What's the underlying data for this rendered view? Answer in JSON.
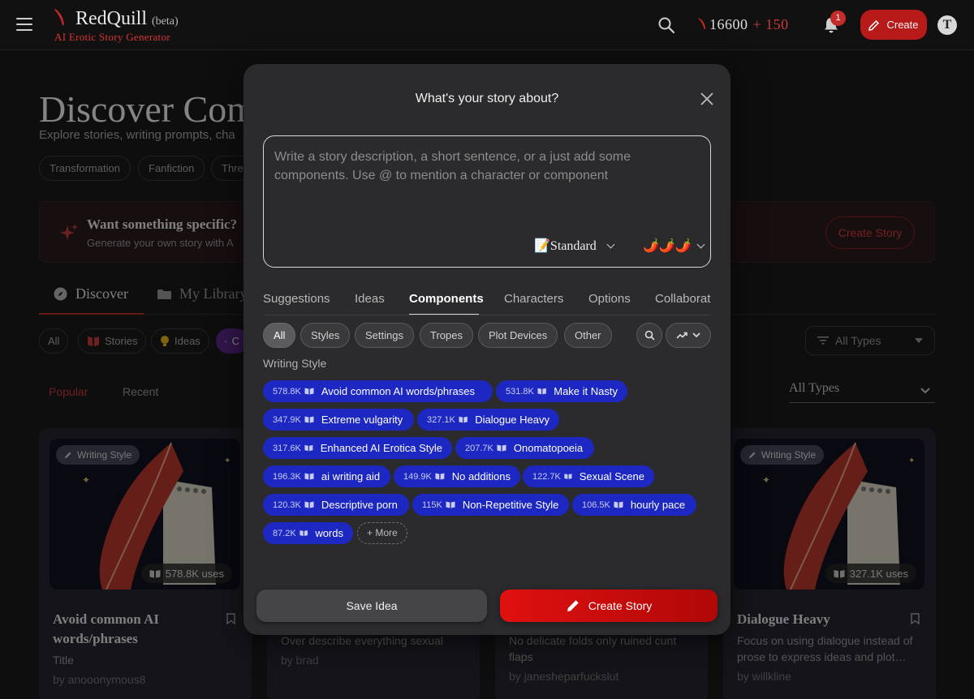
{
  "app": {
    "name": "RedQuill",
    "beta": "(beta)",
    "subtitle": "AI Erotic Story Generator",
    "credits": "16600",
    "credits_bonus": "+ 150",
    "notification_count": "1",
    "create_label": "Create",
    "avatar_letter": "T",
    "brand_color": "#c42b2b"
  },
  "page": {
    "title": "Discover Com",
    "subtitle": "Explore stories, writing prompts, cha",
    "tags": [
      "Transformation",
      "Fanfiction",
      "Thre"
    ],
    "promo_title": "Want something specific?",
    "promo_sub": "Generate your own story with A",
    "promo_button": "Create Story",
    "tabs": [
      {
        "label": "Discover",
        "icon": "compass-icon"
      },
      {
        "label": "My Library",
        "icon": "folder-icon"
      }
    ],
    "filters": [
      {
        "label": "All",
        "icon": ""
      },
      {
        "label": "Stories",
        "icon": "book-icon"
      },
      {
        "label": "Ideas",
        "icon": "lightbulb-icon"
      },
      {
        "label": "C",
        "icon": "puzzle-icon"
      }
    ],
    "type_select": "All Types",
    "sort_tabs": [
      "Popular",
      "Recent"
    ],
    "all_types_label": "All Types",
    "cards": [
      {
        "badge": "Writing Style",
        "uses": "578.8K uses",
        "title": "Avoid common AI words/phrases",
        "desc": "Title",
        "author": "by anooonymous8"
      },
      {
        "badge": "",
        "uses": "",
        "title": "",
        "desc": "Over describe everything sexual",
        "author": "by brad"
      },
      {
        "badge": "",
        "uses": "",
        "title": "",
        "desc": "No delicate folds only ruined cunt flaps",
        "author": "by janesheparfuckslut"
      },
      {
        "badge": "Writing Style",
        "uses": "327.1K uses",
        "title": "Dialogue Heavy",
        "desc": "Focus on using dialogue instead of prose to express ideas and plot…",
        "author": "by willkline"
      }
    ]
  },
  "modal": {
    "title": "What's your story about?",
    "placeholder": "Write a story description, a short sentence, or a just add some components. Use @ to mention a character or component",
    "style_label": "📝Standard",
    "spice": "🌶️🌶️🌶️",
    "tabs": [
      "Suggestions",
      "Ideas",
      "Components",
      "Characters",
      "Options",
      "Collaborat"
    ],
    "active_tab": "Components",
    "categories": [
      "All",
      "Styles",
      "Settings",
      "Tropes",
      "Plot Devices",
      "Other"
    ],
    "section": "Writing Style",
    "components": [
      {
        "count": "578.8K",
        "name": "Avoid common AI words/phrases"
      },
      {
        "count": "531.8K",
        "name": "Make it Nasty"
      },
      {
        "count": "347.9K",
        "name": "Extreme vulgarity"
      },
      {
        "count": "327.1K",
        "name": "Dialogue Heavy"
      },
      {
        "count": "317.6K",
        "name": "Enhanced AI Erotica Style"
      },
      {
        "count": "207.7K",
        "name": "Onomatopoeia"
      },
      {
        "count": "196.3K",
        "name": "ai writing aid"
      },
      {
        "count": "149.9K",
        "name": "No additions"
      },
      {
        "count": "122.7K",
        "name": "Sexual Scene"
      },
      {
        "count": "120.3K",
        "name": "Descriptive porn"
      },
      {
        "count": "115K",
        "name": "Non-Repetitive Style"
      },
      {
        "count": "106.5K",
        "name": "hourly pace"
      },
      {
        "count": "87.2K",
        "name": "words"
      }
    ],
    "more_label": "+ More",
    "save_label": "Save Idea",
    "create_label": "Create Story",
    "pill_color": "#1d28c2"
  }
}
